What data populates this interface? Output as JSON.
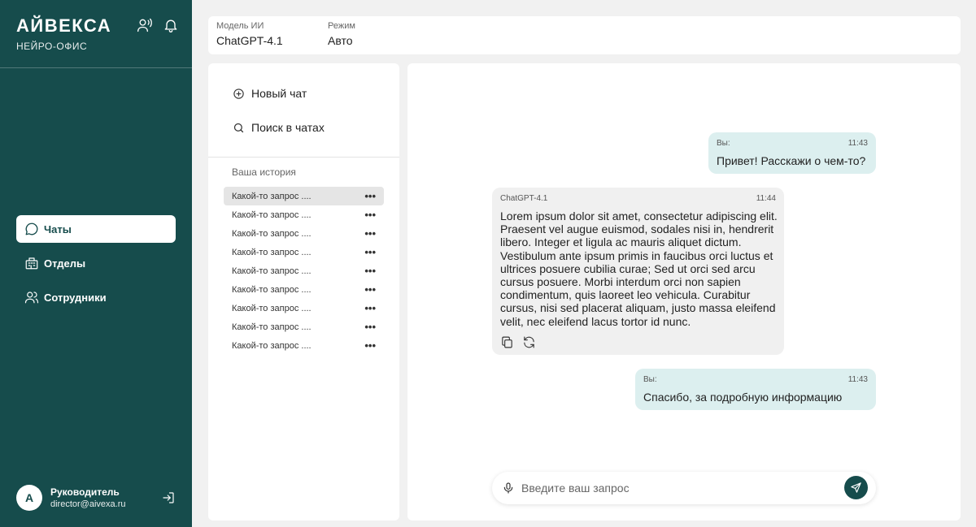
{
  "brand": {
    "title": "АЙВЕКСА",
    "subtitle": "НЕЙРО-ОФИС"
  },
  "sidebar": {
    "items": [
      {
        "label": "Чаты",
        "icon": "chat-bubble-icon",
        "active": true
      },
      {
        "label": "Отделы",
        "icon": "building-icon",
        "active": false
      },
      {
        "label": "Сотрудники",
        "icon": "users-icon",
        "active": false
      }
    ]
  },
  "user": {
    "avatar_letter": "А",
    "name": "Руководитель",
    "email": "director@aivexa.ru"
  },
  "header": {
    "model_label": "Модель ИИ",
    "model_value": "ChatGPT-4.1",
    "mode_label": "Режим",
    "mode_value": "Авто"
  },
  "history": {
    "new_chat": "Новый чат",
    "search": "Поиск в чатах",
    "title": "Ваша история",
    "items": [
      "Какой-то запрос ....",
      "Какой-то запрос ....",
      "Какой-то запрос ....",
      "Какой-то запрос ....",
      "Какой-то запрос ....",
      "Какой-то запрос ....",
      "Какой-то запрос ....",
      "Какой-то запрос ....",
      "Какой-то запрос ...."
    ],
    "more_glyph": "•••"
  },
  "chat": {
    "messages": [
      {
        "sender": "Вы:",
        "time": "11:43",
        "text": "Привет! Расскажи о чем-то?"
      },
      {
        "sender": "ChatGPT-4.1",
        "time": "11:44",
        "text": "Lorem ipsum dolor sit amet, consectetur adipiscing elit. Praesent vel augue euismod, sodales nisi in, hendrerit libero. Integer et ligula ac mauris aliquet dictum. Vestibulum ante ipsum primis in faucibus orci luctus et ultrices posuere cubilia curae; Sed ut orci sed arcu cursus posuere. Morbi interdum orci non sapien condimentum, quis laoreet leo vehicula. Curabitur cursus, nisi sed placerat aliquam, justo massa eleifend velit, nec eleifend lacus tortor id nunc."
      },
      {
        "sender": "Вы:",
        "time": "11:43",
        "text": "Спасибо, за подробную информацию"
      }
    ],
    "input_placeholder": "Введите ваш запрос"
  },
  "colors": {
    "primary": "#164c4c",
    "user_bubble": "#dcefef",
    "bot_bubble": "#f0f0f0",
    "page_bg": "#f1f1f1"
  }
}
